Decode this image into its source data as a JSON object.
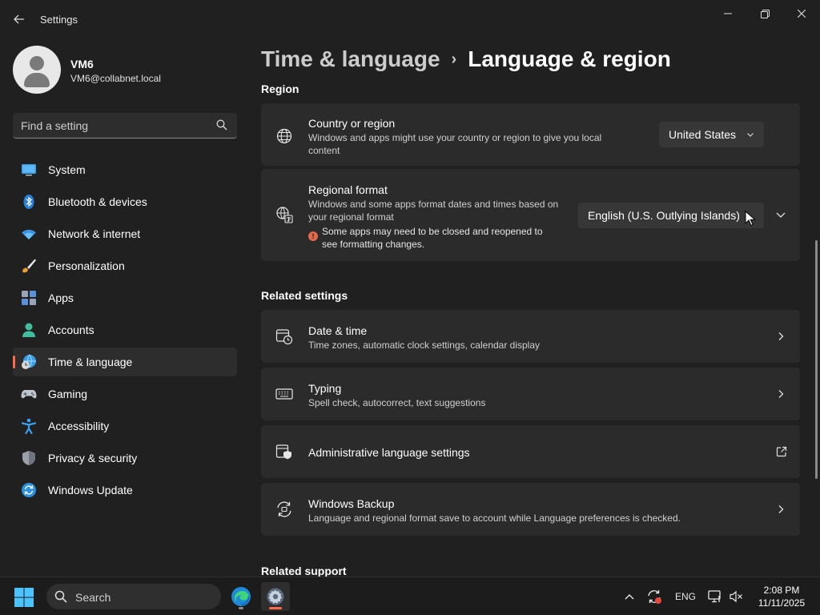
{
  "window": {
    "title": "Settings"
  },
  "user": {
    "name": "VM6",
    "email": "VM6@collabnet.local"
  },
  "search": {
    "placeholder": "Find a setting"
  },
  "sidebar": {
    "items": [
      {
        "label": "System",
        "icon": "system-icon"
      },
      {
        "label": "Bluetooth & devices",
        "icon": "bluetooth-icon"
      },
      {
        "label": "Network & internet",
        "icon": "wifi-icon"
      },
      {
        "label": "Personalization",
        "icon": "brush-icon"
      },
      {
        "label": "Apps",
        "icon": "apps-icon"
      },
      {
        "label": "Accounts",
        "icon": "accounts-icon"
      },
      {
        "label": "Time & language",
        "icon": "globe-clock-icon",
        "active": true
      },
      {
        "label": "Gaming",
        "icon": "gamepad-icon"
      },
      {
        "label": "Accessibility",
        "icon": "accessibility-icon"
      },
      {
        "label": "Privacy & security",
        "icon": "shield-icon"
      },
      {
        "label": "Windows Update",
        "icon": "update-icon"
      }
    ]
  },
  "breadcrumb": {
    "parent": "Time & language",
    "separator": "›",
    "current": "Language & region"
  },
  "region": {
    "heading": "Region",
    "country": {
      "title": "Country or region",
      "desc": "Windows and apps might use your country or region to give you local content",
      "value": "United States"
    },
    "format": {
      "title": "Regional format",
      "desc": "Windows and some apps format dates and times based on your regional format",
      "value": "English (U.S. Outlying Islands)",
      "warning": "Some apps may need to be closed and reopened to see formatting changes."
    }
  },
  "related": {
    "heading": "Related settings",
    "items": [
      {
        "title": "Date & time",
        "desc": "Time zones, automatic clock settings, calendar display",
        "icon": "date-time-icon"
      },
      {
        "title": "Typing",
        "desc": "Spell check, autocorrect, text suggestions",
        "icon": "keyboard-icon"
      },
      {
        "title": "Administrative language settings",
        "desc": "",
        "icon": "admin-language-icon"
      },
      {
        "title": "Windows Backup",
        "desc": "Language and regional format save to account while Language preferences is checked.",
        "icon": "backup-icon"
      }
    ]
  },
  "support": {
    "heading": "Related support"
  },
  "taskbar": {
    "search_label": "Search",
    "language": "ENG",
    "time": "2:08 PM",
    "date": "11/11/2025"
  },
  "colors": {
    "accent": "#ff6b4a",
    "background": "#202020",
    "card": "#2b2b2b"
  }
}
